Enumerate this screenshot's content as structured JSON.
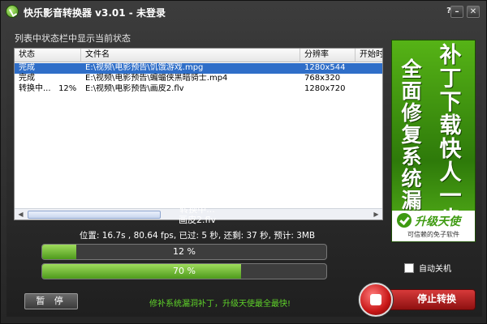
{
  "window": {
    "title": "快乐影音转换器 v3.01 - 未登录",
    "help_label": "?",
    "minimize_label": "–",
    "close_label": "✕"
  },
  "list": {
    "caption": "列表中状态栏中显示当前状态",
    "columns": {
      "status": "状态",
      "file": "文件名",
      "resolution": "分辨率",
      "start": "开始时"
    },
    "rows": [
      {
        "status": "完成",
        "file": "E:\\视频\\电影预告\\饥饿游戏.mpg",
        "resolution": "1280x544",
        "selected": true
      },
      {
        "status": "完成",
        "file": "E:\\视频\\电影预告\\蝙蝠侠黑暗骑士.mp4",
        "resolution": "768x320",
        "selected": false
      },
      {
        "status": "转换中...   12%",
        "file": "E:\\视频\\电影预告\\画皮2.flv",
        "resolution": "1280x720",
        "selected": false
      }
    ]
  },
  "progress": {
    "state": "转换中...",
    "file": "画皮2.flv",
    "stats": "位置: 16.7s , 80.64 fps, 已过: 5 秒, 还剩: 37 秒, 预计: 3MB",
    "bar1": {
      "percent": 12,
      "label": "12 %"
    },
    "bar2": {
      "percent": 70,
      "label": "70 %"
    }
  },
  "controls": {
    "pause_label": "暂 停",
    "footer_link": "修补系统漏洞补丁，升级天使最全最快!",
    "auto_shutdown_label": "自动关机",
    "auto_shutdown_checked": false,
    "stop_label": "停止转换"
  },
  "ad": {
    "left_text": "全面修复系统漏洞",
    "right_text": "补丁下载快人一步",
    "logo": "升级天使",
    "slogan": "可信赖的免子软件"
  },
  "colors": {
    "accent_green": "#5fd32a",
    "selection_blue": "#2f6ec8",
    "stop_red": "#c81717"
  }
}
